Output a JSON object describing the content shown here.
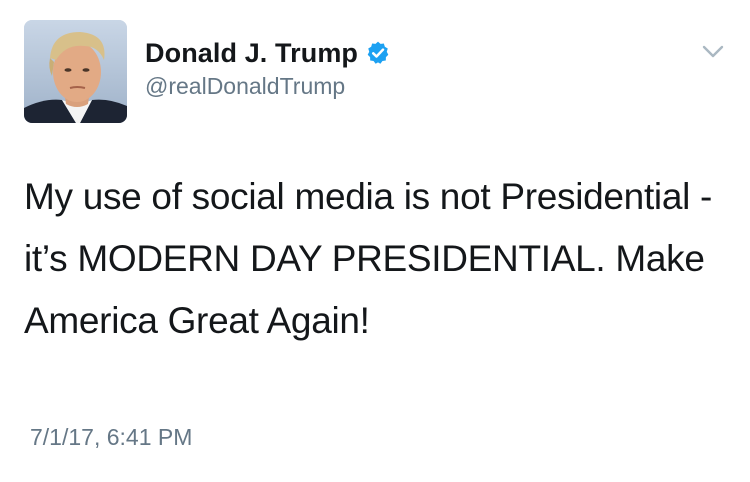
{
  "tweet": {
    "author": {
      "display_name": "Donald J. Trump",
      "handle": "@realDonaldTrump",
      "verified": true,
      "avatar_icon": "profile-photo"
    },
    "text": "My use of social media is not Presidential - it’s MODERN DAY PRESIDENTIAL. Make America Great Again!",
    "timestamp": "7/1/17, 6:41 PM",
    "menu_icon": "chevron-down-icon"
  },
  "colors": {
    "text_primary": "#14171a",
    "text_secondary": "#657786",
    "verified_blue": "#1da1f2",
    "caret_gray": "#aab8c2"
  }
}
